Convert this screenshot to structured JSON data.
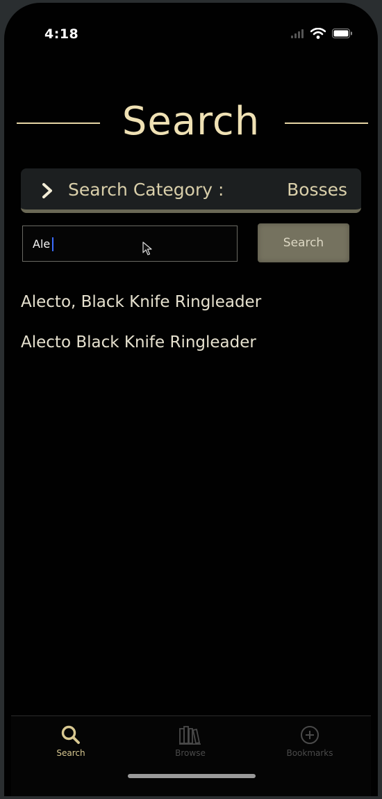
{
  "status_bar": {
    "time": "4:18",
    "icons": [
      "signal-icon",
      "wifi-icon",
      "battery-icon"
    ]
  },
  "page": {
    "title": "Search"
  },
  "category": {
    "label": "Search Category :",
    "value": "Bosses"
  },
  "search": {
    "input_value": "Ale",
    "button_label": "Search"
  },
  "results": [
    "Alecto, Black Knife Ringleader",
    "Alecto Black Knife Ringleader"
  ],
  "tabbar": {
    "tabs": [
      {
        "label": "Search",
        "icon": "magnifier-icon",
        "active": true
      },
      {
        "label": "Browse",
        "icon": "books-icon",
        "active": false
      },
      {
        "label": "Bookmarks",
        "icon": "plus-circle-icon",
        "active": false
      }
    ]
  },
  "colors": {
    "accent": "#efe1b4",
    "button": "#75725f",
    "background": "#010101",
    "caret": "#3b6cff"
  }
}
